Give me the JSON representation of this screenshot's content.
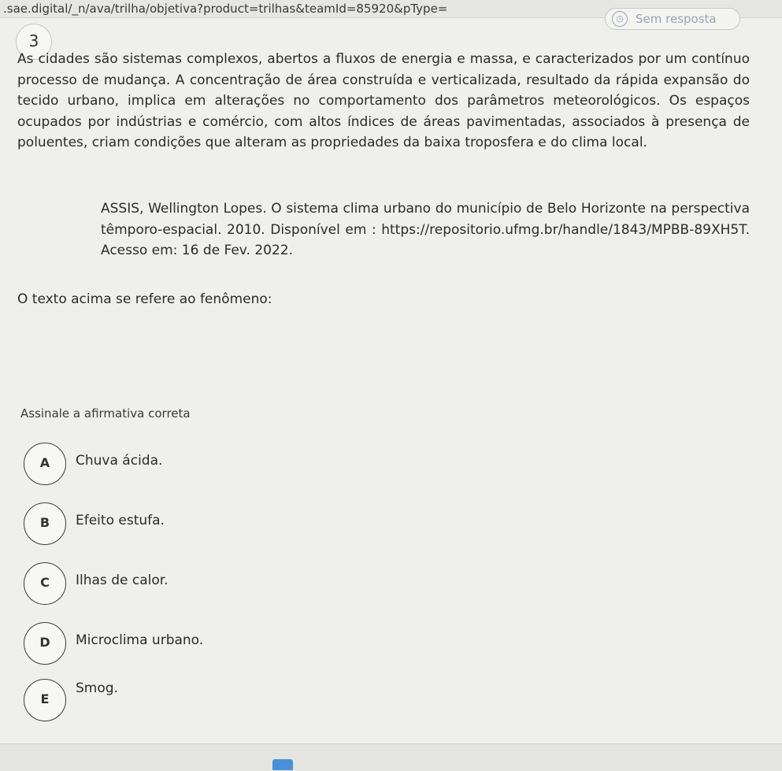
{
  "browser": {
    "url": ".sae.digital/_n/ava/trilha/objetiva?product=trilhas&teamId=85920&pType="
  },
  "question": {
    "number": "3",
    "status": "Sem resposta",
    "status_icon": "clock-icon",
    "paragraph": "As cidades são sistemas complexos, abertos a fluxos de energia e massa, e caracterizados por um contínuo processo de mudança. A concentração de área construída e verticalizada, resultado da rápida expansão do tecido urbano, implica em alterações no comportamento dos parâmetros meteorológicos. Os espaços ocupados por indústrias e comércio, com altos índices de áreas pavimentadas, associados à presença de poluentes, criam condições que alteram as propriedades da baixa troposfera e do clima local.",
    "citation": "ASSIS, Wellington Lopes. O sistema clima urbano do município de Belo Horizonte na perspectiva têmporo-espacial. 2010. Disponível em : https://repositorio.ufmg.br/handle/1843/MPBB-89XH5T. Acesso em: 16 de Fev. 2022.",
    "prompt": "O texto acima se refere ao fenômeno:",
    "instruction": "Assinale a afirmativa correta"
  },
  "options": [
    {
      "letter": "A",
      "text": "Chuva ácida."
    },
    {
      "letter": "B",
      "text": "Efeito estufa."
    },
    {
      "letter": "C",
      "text": "Ilhas de calor."
    },
    {
      "letter": "D",
      "text": "Microclima urbano."
    },
    {
      "letter": "E",
      "text": "Smog."
    }
  ],
  "colors": {
    "background": "#efefec",
    "status_text": "#9aa6b5",
    "text": "#2b2b2b"
  }
}
